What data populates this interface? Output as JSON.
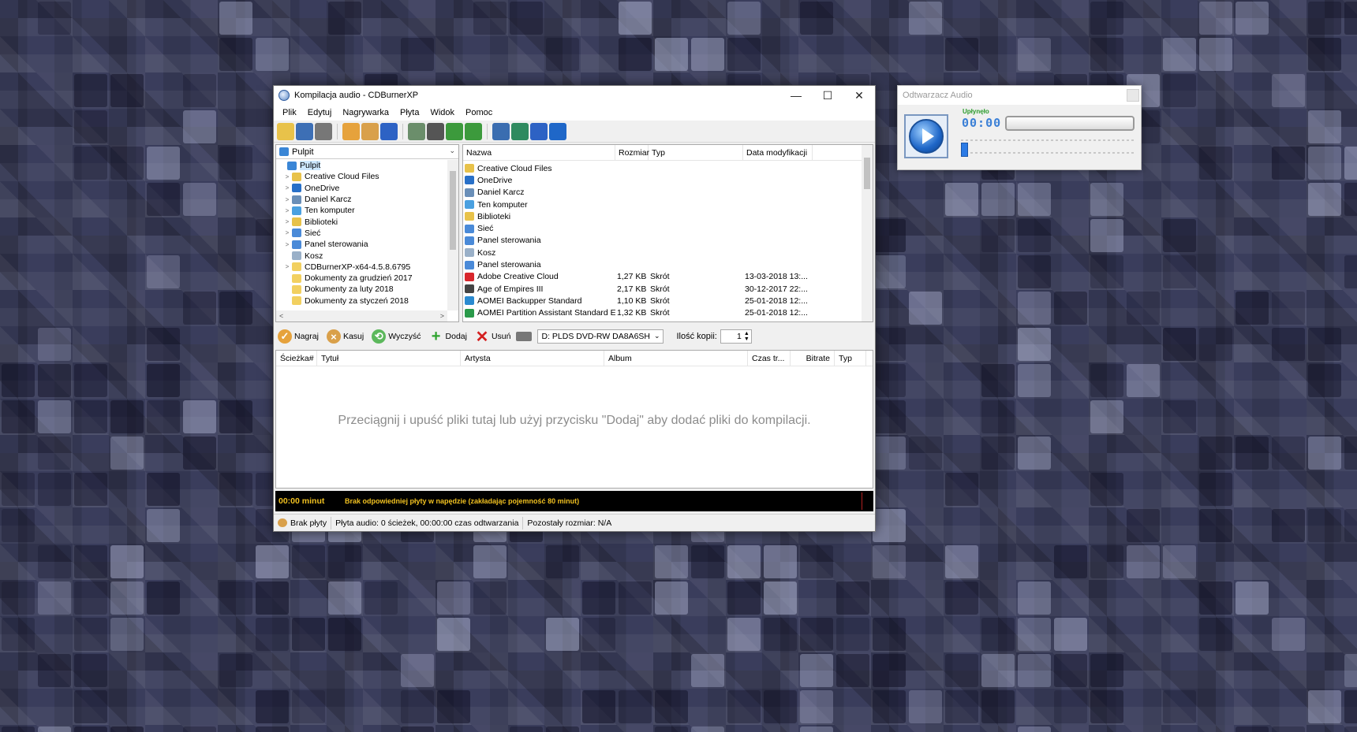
{
  "window": {
    "title": "Kompilacja audio - CDBurnerXP",
    "controls": {
      "minimize": "—",
      "maximize": "☐",
      "close": "✕"
    }
  },
  "menu": [
    "Plik",
    "Edytuj",
    "Nagrywarka",
    "Płyta",
    "Widok",
    "Pomoc"
  ],
  "toolbar_icons": [
    {
      "name": "new-folder-icon",
      "color": "#e8c24a"
    },
    {
      "name": "save-icon",
      "color": "#3d6fb5"
    },
    {
      "name": "print-icon",
      "color": "#777777"
    },
    {
      "name": "burn-disc-icon",
      "color": "#e6a23c"
    },
    {
      "name": "erase-disc-icon",
      "color": "#d9a04a"
    },
    {
      "name": "compilation-icon",
      "color": "#2d62c4"
    },
    {
      "name": "copy-disc-icon",
      "color": "#6b8e6b"
    },
    {
      "name": "drive-icon",
      "color": "#555555"
    },
    {
      "name": "disc-green-icon",
      "color": "#3c9a3c"
    },
    {
      "name": "disc-refresh-icon",
      "color": "#3c9a3c"
    },
    {
      "name": "settings-gear-icon",
      "color": "#3a6db0"
    },
    {
      "name": "globe-icon",
      "color": "#2f8a5f"
    },
    {
      "name": "help-icon",
      "color": "#2d62c4"
    },
    {
      "name": "info-icon",
      "color": "#1f67c8"
    }
  ],
  "tree": {
    "combo_value": "Pulpit",
    "items": [
      {
        "label": "Pulpit",
        "level": 0,
        "expander": "",
        "icon": "#3a86d6",
        "selected": true
      },
      {
        "label": "Creative Cloud Files",
        "level": 1,
        "expander": ">",
        "icon": "#e8c24a"
      },
      {
        "label": "OneDrive",
        "level": 1,
        "expander": ">",
        "icon": "#2870c8"
      },
      {
        "label": "Daniel Karcz",
        "level": 1,
        "expander": ">",
        "icon": "#6a8fb8"
      },
      {
        "label": "Ten komputer",
        "level": 1,
        "expander": ">",
        "icon": "#4aa0e0"
      },
      {
        "label": "Biblioteki",
        "level": 1,
        "expander": ">",
        "icon": "#e8c24a"
      },
      {
        "label": "Sieć",
        "level": 1,
        "expander": ">",
        "icon": "#4a8ad8"
      },
      {
        "label": "Panel sterowania",
        "level": 1,
        "expander": ">",
        "icon": "#4a8ad8"
      },
      {
        "label": "Kosz",
        "level": 1,
        "expander": "",
        "icon": "#9ab0c8"
      },
      {
        "label": "CDBurnerXP-x64-4.5.8.6795",
        "level": 1,
        "expander": ">",
        "icon": "#f2d060"
      },
      {
        "label": "Dokumenty za grudzień 2017",
        "level": 1,
        "expander": "",
        "icon": "#f2d060"
      },
      {
        "label": "Dokumenty za luty 2018",
        "level": 1,
        "expander": "",
        "icon": "#f2d060"
      },
      {
        "label": "Dokumenty za styczeń 2018",
        "level": 1,
        "expander": "",
        "icon": "#f2d060"
      }
    ]
  },
  "files": {
    "headers": [
      "Nazwa",
      "Rozmiar",
      "Typ",
      "Data modyfikacji"
    ],
    "rows": [
      {
        "name": "Creative Cloud Files",
        "size": "",
        "type": "",
        "date": "",
        "icon": "#e8c24a"
      },
      {
        "name": "OneDrive",
        "size": "",
        "type": "",
        "date": "",
        "icon": "#2870c8"
      },
      {
        "name": "Daniel Karcz",
        "size": "",
        "type": "",
        "date": "",
        "icon": "#6a8fb8"
      },
      {
        "name": "Ten komputer",
        "size": "",
        "type": "",
        "date": "",
        "icon": "#4aa0e0"
      },
      {
        "name": "Biblioteki",
        "size": "",
        "type": "",
        "date": "",
        "icon": "#e8c24a"
      },
      {
        "name": "Sieć",
        "size": "",
        "type": "",
        "date": "",
        "icon": "#4a8ad8"
      },
      {
        "name": "Panel sterowania",
        "size": "",
        "type": "",
        "date": "",
        "icon": "#4a8ad8"
      },
      {
        "name": "Kosz",
        "size": "",
        "type": "",
        "date": "",
        "icon": "#9ab0c8"
      },
      {
        "name": "Panel sterowania",
        "size": "",
        "type": "",
        "date": "",
        "icon": "#4a8ad8"
      },
      {
        "name": "Adobe Creative Cloud",
        "size": "1,27 KB",
        "type": "Skrót",
        "date": "13-03-2018 13:...",
        "icon": "#d8262c"
      },
      {
        "name": "Age of Empires III",
        "size": "2,17 KB",
        "type": "Skrót",
        "date": "30-12-2017 22:...",
        "icon": "#444444"
      },
      {
        "name": "AOMEI Backupper Standard",
        "size": "1,10 KB",
        "type": "Skrót",
        "date": "25-01-2018 12:...",
        "icon": "#2a8ad0"
      },
      {
        "name": "AOMEI Partition Assistant Standard Edition...",
        "size": "1,32 KB",
        "type": "Skrót",
        "date": "25-01-2018 12:...",
        "icon": "#2a9a4a"
      }
    ]
  },
  "compilation_toolbar": {
    "burn": "Nagraj",
    "erase": "Kasuj",
    "clear": "Wyczyść",
    "add": "Dodaj",
    "remove": "Usuń",
    "drive": "D: PLDS DVD-RW DA8A6SH",
    "copies_label": "Ilość kopii:",
    "copies_value": "1"
  },
  "compilation_list": {
    "headers": [
      "Ścieżka#",
      "Tytuł",
      "Artysta",
      "Album",
      "Czas tr...",
      "Bitrate",
      "Typ"
    ],
    "empty_hint": "Przeciągnij i upuść pliki tutaj lub użyj przycisku \"Dodaj\" aby dodać pliki do kompilacji."
  },
  "capacity": {
    "time": "00:00 minut",
    "message": "Brak odpowiedniej płyty w napędzie (zakładając pojemność 80 minut)"
  },
  "status": {
    "disc": "Brak płyty",
    "audio_info": "Płyta audio: 0 ścieżek, 00:00:00 czas odtwarzania",
    "remaining": "Pozostały rozmiar: N/A"
  },
  "player": {
    "title": "Odtwarzacz Audio",
    "elapsed_label": "Upłynęło",
    "elapsed_time": "00:00"
  }
}
